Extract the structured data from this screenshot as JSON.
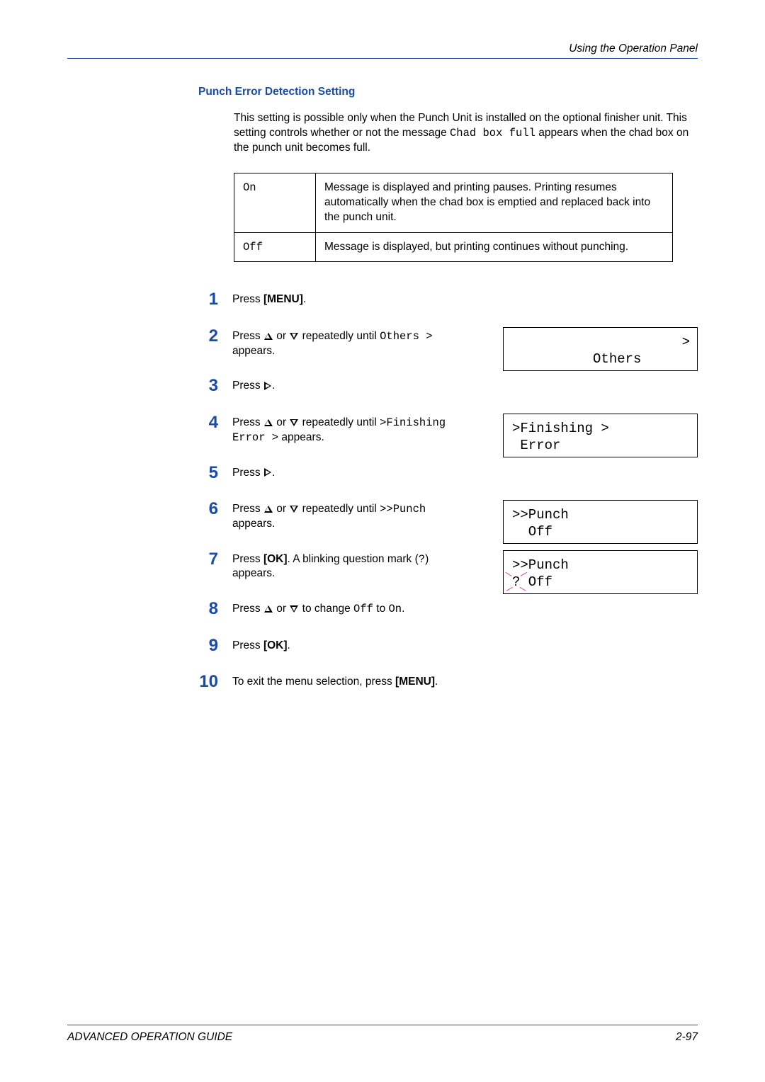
{
  "header": {
    "chapter": "Using the Operation Panel"
  },
  "section_title": "Punch Error Detection Setting",
  "intro": {
    "p1a": "This setting is possible only when the Punch Unit is installed on the optional finisher unit. This setting controls whether or not the message ",
    "p1_code": "Chad box full",
    "p1b": " appears when the chad box on the punch unit becomes full."
  },
  "options_table": {
    "rows": [
      {
        "opt": "On",
        "desc": "Message is displayed and printing pauses. Printing resumes automatically when the chad box is emptied and replaced back into the punch unit."
      },
      {
        "opt": "Off",
        "desc": "Message is displayed, but printing continues without punching."
      }
    ]
  },
  "steps": {
    "s1": {
      "num": "1",
      "a": "Press ",
      "bold": "[MENU]",
      "b": "."
    },
    "s2": {
      "num": "2",
      "a": "Press ",
      "mid": " or ",
      "b": " repeatedly until ",
      "code": "Others >",
      "c": " appears.",
      "lcd_line1": "Others",
      "lcd_gt": ">"
    },
    "s3": {
      "num": "3",
      "a": "Press ",
      "b": "."
    },
    "s4": {
      "num": "4",
      "a": "Press ",
      "mid": " or ",
      "b": " repeatedly until ",
      "code": ">Finishing Error >",
      "c": " appears.",
      "lcd_line1": ">Finishing >",
      "lcd_line2": " Error"
    },
    "s5": {
      "num": "5",
      "a": "Press ",
      "b": "."
    },
    "s6": {
      "num": "6",
      "a": "Press ",
      "mid": " or ",
      "b": " repeatedly until ",
      "code": ">>Punch",
      "c": " appears.",
      "lcd_line1": ">>Punch",
      "lcd_line2": "  Off"
    },
    "s7": {
      "num": "7",
      "a": "Press ",
      "bold": "[OK]",
      "b": ". A blinking question mark (",
      "code": "?",
      "c": ") appears.",
      "lcd_line1": ">>Punch",
      "lcd_q": "?",
      "lcd_after_q": " Off"
    },
    "s8": {
      "num": "8",
      "a": "Press ",
      "mid": " or ",
      "b": " to change ",
      "code1": "Off",
      "c": " to ",
      "code2": "On",
      "d": "."
    },
    "s9": {
      "num": "9",
      "a": "Press ",
      "bold": "[OK]",
      "b": "."
    },
    "s10": {
      "num": "10",
      "a": "To exit the menu selection, press ",
      "bold": "[MENU]",
      "b": "."
    }
  },
  "footer": {
    "left": "ADVANCED OPERATION GUIDE",
    "right": "2-97"
  }
}
